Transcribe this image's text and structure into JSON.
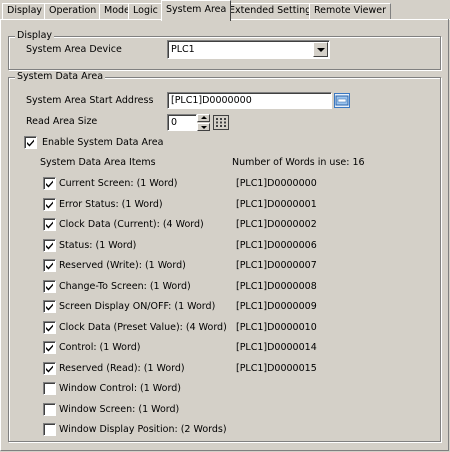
{
  "tabs": [
    {
      "label": "Display",
      "active": false
    },
    {
      "label": "Operation",
      "active": false
    },
    {
      "label": "Mode",
      "active": false
    },
    {
      "label": "Logic",
      "active": false
    },
    {
      "label": "System Area",
      "active": true
    },
    {
      "label": "Extended Settings",
      "active": false
    },
    {
      "label": "Remote Viewer",
      "active": false
    }
  ],
  "display_group": {
    "title": "Display",
    "device_label": "System Area Device",
    "device_value": "PLC1"
  },
  "system_data_area": {
    "title": "System Data Area",
    "start_address_label": "System Area Start Address",
    "start_address_value": "[PLC1]D0000000",
    "read_area_size_label": "Read Area Size",
    "read_area_size_value": "0",
    "enable_label": "Enable System Data Area",
    "enable_checked": true,
    "items_header": "System Data Area Items",
    "words_in_use_label": "Number of Words in use: 16",
    "items": [
      {
        "label": "Current Screen: (1 Word)",
        "checked": true,
        "address": "[PLC1]D0000000"
      },
      {
        "label": "Error Status: (1 Word)",
        "checked": true,
        "address": "[PLC1]D0000001"
      },
      {
        "label": "Clock Data (Current): (4 Word)",
        "checked": true,
        "address": "[PLC1]D0000002"
      },
      {
        "label": "Status: (1 Word)",
        "checked": true,
        "address": "[PLC1]D0000006"
      },
      {
        "label": "Reserved (Write): (1 Word)",
        "checked": true,
        "address": "[PLC1]D0000007"
      },
      {
        "label": "Change-To Screen: (1 Word)",
        "checked": true,
        "address": "[PLC1]D0000008"
      },
      {
        "label": "Screen Display ON/OFF: (1 Word)",
        "checked": true,
        "address": "[PLC1]D0000009"
      },
      {
        "label": "Clock Data (Preset Value): (4 Word)",
        "checked": true,
        "address": "[PLC1]D0000010"
      },
      {
        "label": "Control: (1 Word)",
        "checked": true,
        "address": "[PLC1]D0000014"
      },
      {
        "label": "Reserved (Read): (1 Word)",
        "checked": true,
        "address": "[PLC1]D0000015"
      },
      {
        "label": "Window Control: (1 Word)",
        "checked": false,
        "address": ""
      },
      {
        "label": "Window Screen: (1 Word)",
        "checked": false,
        "address": ""
      },
      {
        "label": "Window Display Position: (2 Words)",
        "checked": false,
        "address": ""
      }
    ]
  },
  "icons": {
    "address_input": "address-input-icon",
    "keypad": "keypad-icon",
    "dropdown": "chevron-down-icon"
  }
}
